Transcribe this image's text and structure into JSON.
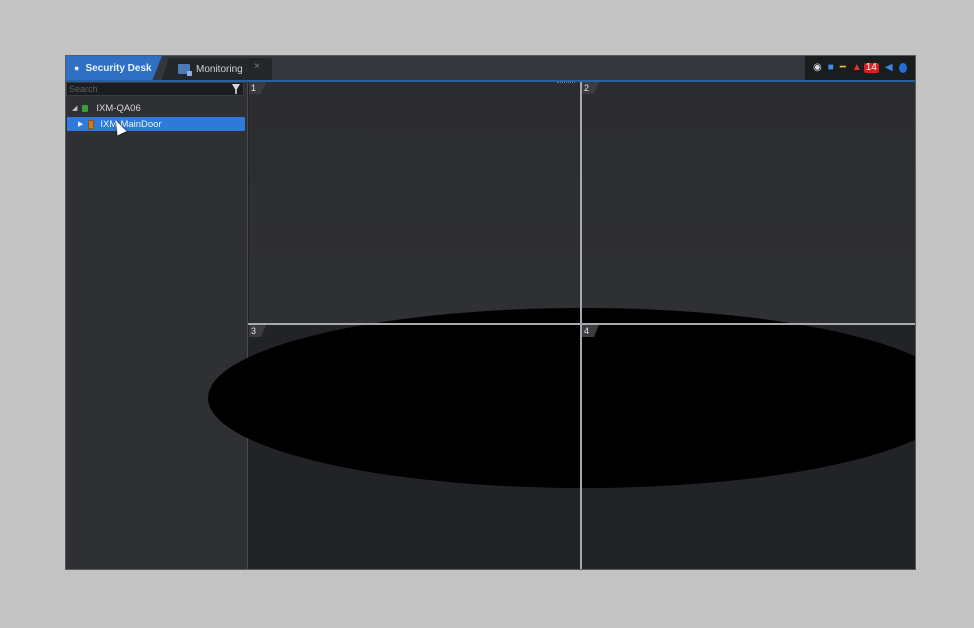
{
  "tabs": {
    "home_label": "Security Desk",
    "monitoring_label": "Monitoring",
    "close_glyph": "×"
  },
  "tray": {
    "alarm_count": "14"
  },
  "sidebar": {
    "search_placeholder": "Search",
    "tree": [
      {
        "label": "IXM-QA06",
        "expanded": true,
        "icon": "computer-icon"
      },
      {
        "label": "IXM-MainDoor",
        "selected": true,
        "icon": "door-icon"
      }
    ]
  },
  "tiles": [
    {
      "number": "1"
    },
    {
      "number": "2"
    },
    {
      "number": "3"
    },
    {
      "number": "4"
    }
  ],
  "colors": {
    "accent": "#2f6fc4",
    "selection": "#2e7ad8",
    "alarm": "#d81e1e"
  }
}
